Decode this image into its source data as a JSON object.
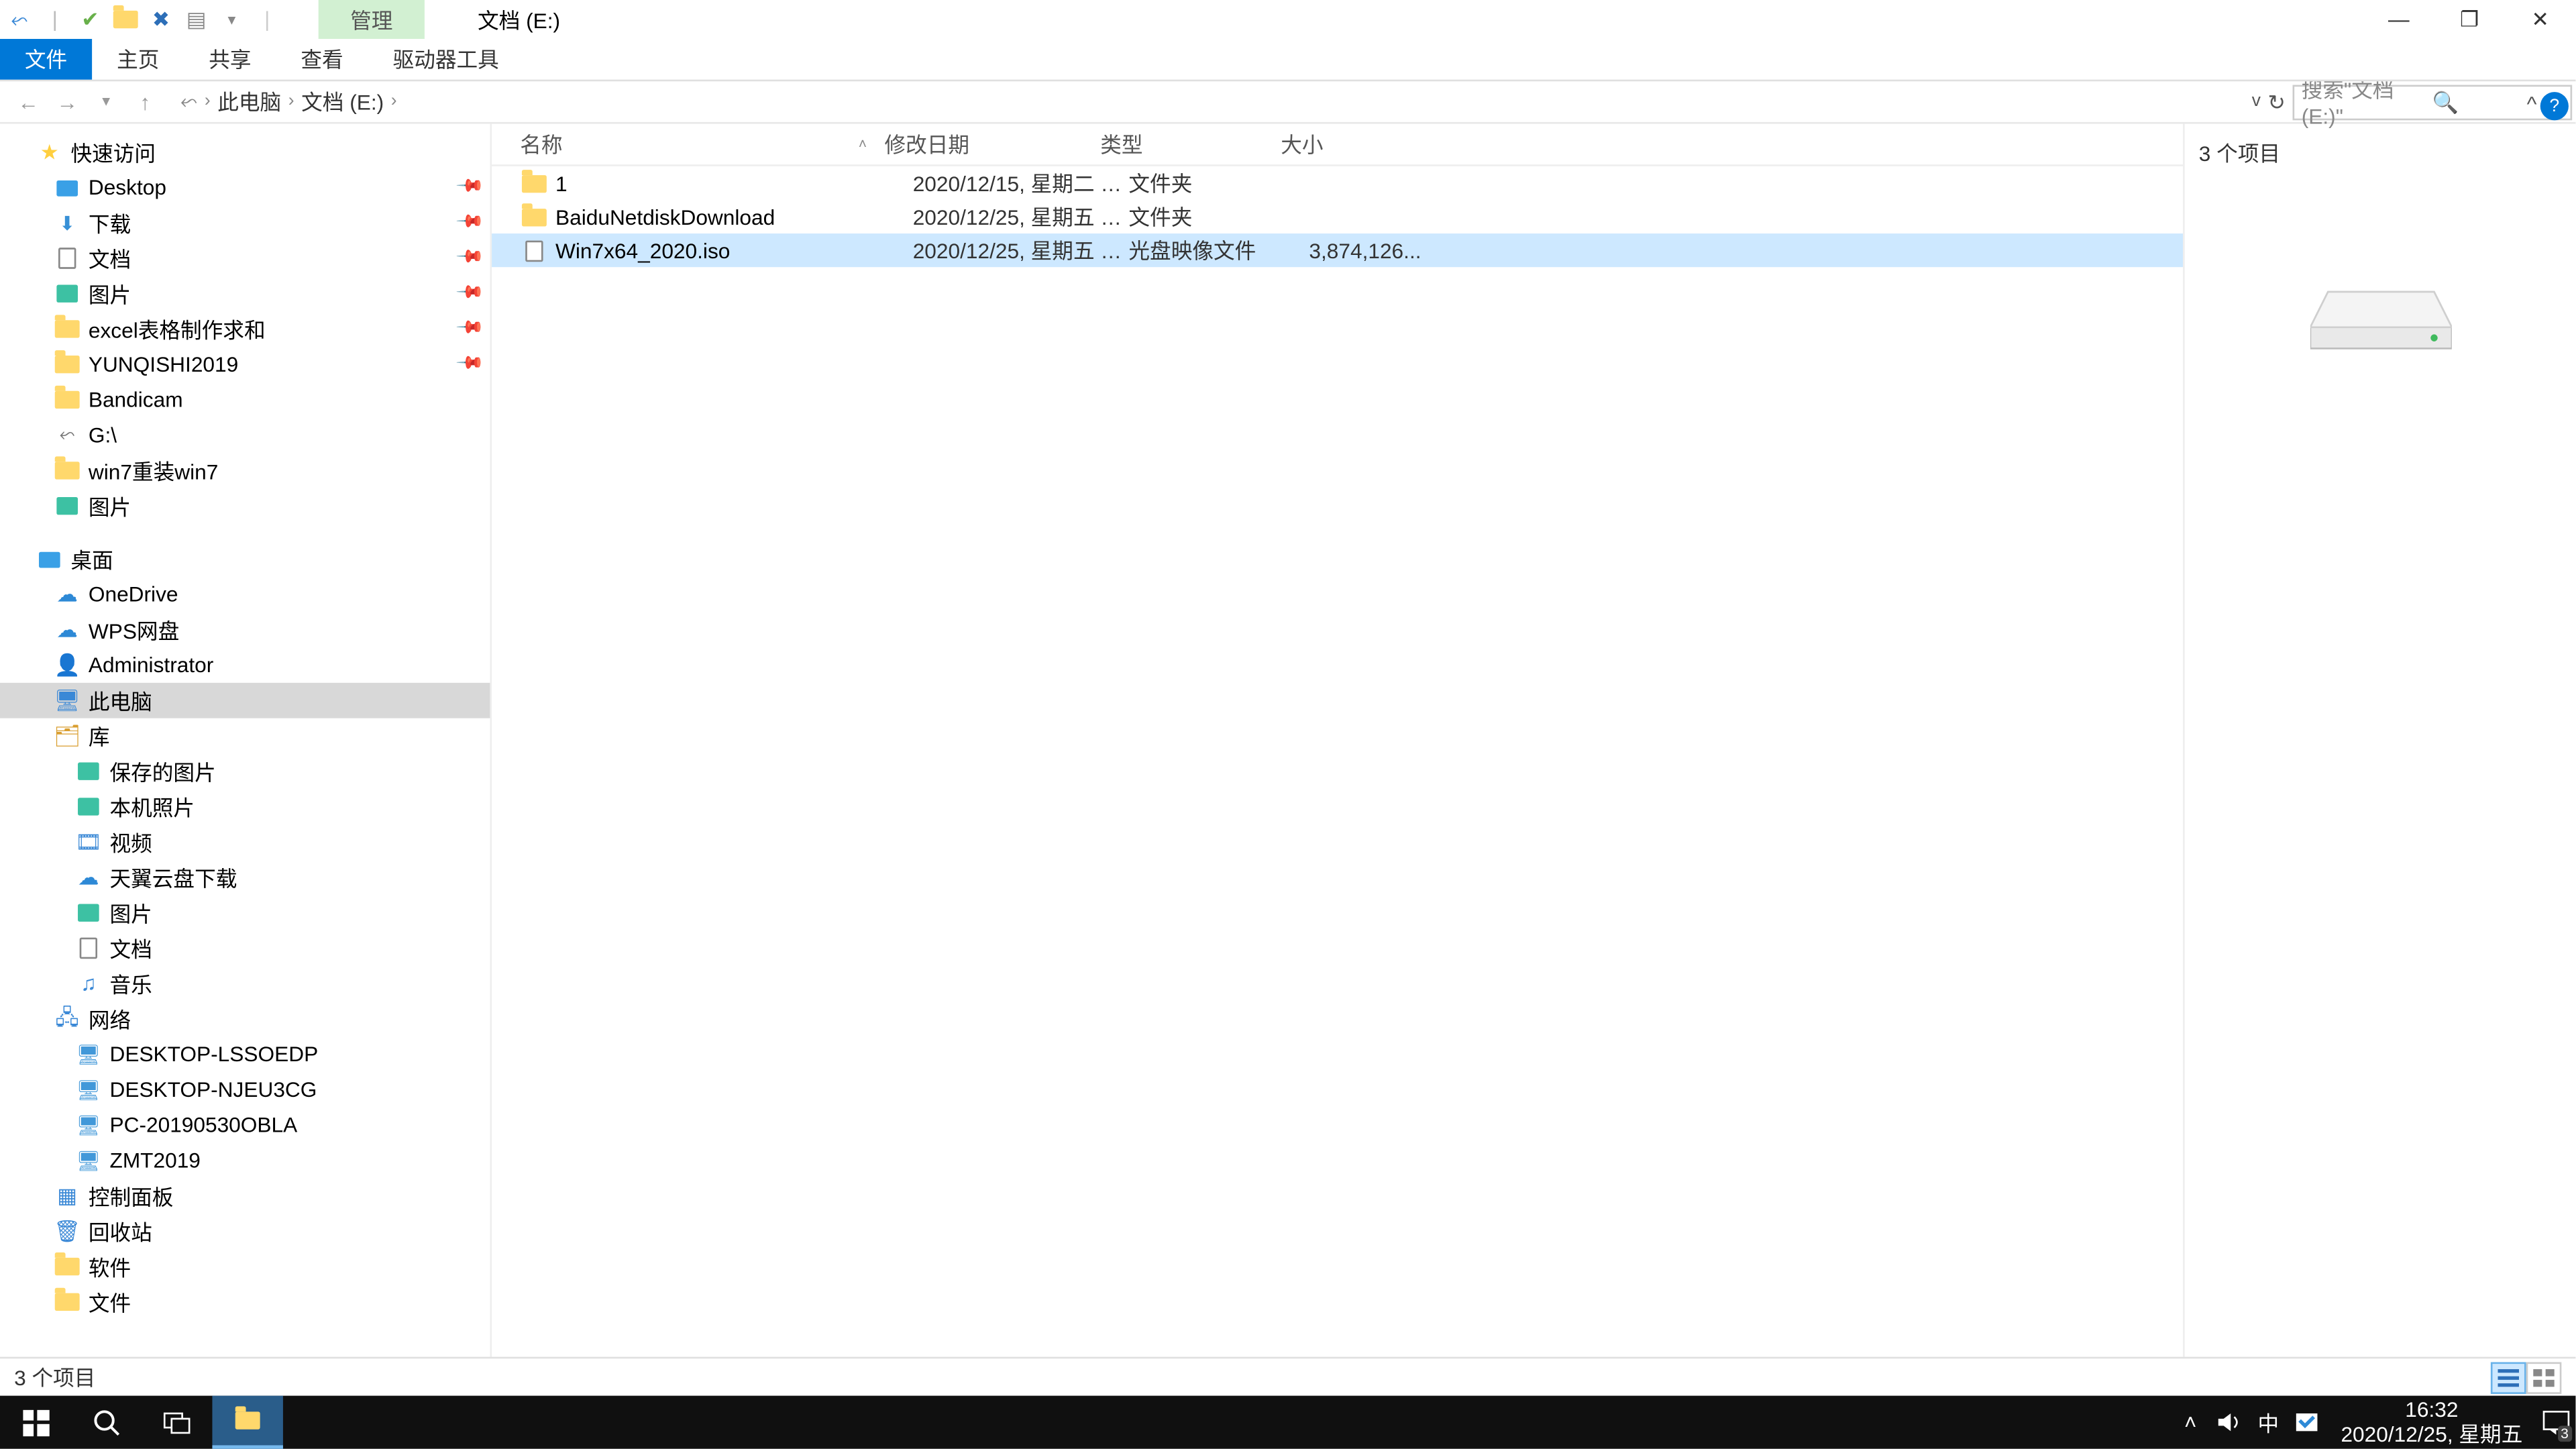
{
  "window": {
    "contextual_tab": "管理",
    "title": "文档 (E:)",
    "minimize": "—",
    "maximize": "❐",
    "close": "✕"
  },
  "ribbon": {
    "tabs": [
      "文件",
      "主页",
      "共享",
      "查看",
      "驱动器工具"
    ],
    "help": "?",
    "expand": "^"
  },
  "breadcrumb": {
    "segments": [
      "此电脑",
      "文档 (E:)"
    ],
    "sep": "›"
  },
  "search": {
    "placeholder": "搜索\"文档 (E:)\"",
    "refresh": "↻"
  },
  "columns": {
    "name": "名称",
    "date": "修改日期",
    "type": "类型",
    "size": "大小"
  },
  "rows": [
    {
      "icon": "folder",
      "name": "1",
      "date": "2020/12/15, 星期二 1...",
      "type": "文件夹",
      "size": ""
    },
    {
      "icon": "folder",
      "name": "BaiduNetdiskDownload",
      "date": "2020/12/25, 星期五 1...",
      "type": "文件夹",
      "size": ""
    },
    {
      "icon": "iso",
      "name": "Win7x64_2020.iso",
      "date": "2020/12/25, 星期五 1...",
      "type": "光盘映像文件",
      "size": "3,874,126..."
    }
  ],
  "selected_row": 2,
  "tree": {
    "quick_access": "快速访问",
    "qa": [
      {
        "icon": "desktop",
        "label": "Desktop",
        "pin": true
      },
      {
        "icon": "download",
        "label": "下载",
        "pin": true
      },
      {
        "icon": "doc",
        "label": "文档",
        "pin": true
      },
      {
        "icon": "pic",
        "label": "图片",
        "pin": true
      },
      {
        "icon": "folder",
        "label": "excel表格制作求和",
        "pin": true
      },
      {
        "icon": "folder",
        "label": "YUNQISHI2019",
        "pin": true
      },
      {
        "icon": "folder",
        "label": "Bandicam",
        "pin": false
      },
      {
        "icon": "disk",
        "label": "G:\\",
        "pin": false
      },
      {
        "icon": "folder",
        "label": "win7重装win7",
        "pin": false
      },
      {
        "icon": "pic",
        "label": "图片",
        "pin": false
      }
    ],
    "desktop": "桌面",
    "dk": [
      {
        "icon": "cloud",
        "label": "OneDrive"
      },
      {
        "icon": "cloud",
        "label": "WPS网盘"
      },
      {
        "icon": "person",
        "label": "Administrator"
      },
      {
        "icon": "monitor",
        "label": "此电脑"
      },
      {
        "icon": "lib",
        "label": "库"
      }
    ],
    "lib": [
      {
        "icon": "pic",
        "label": "保存的图片"
      },
      {
        "icon": "pic",
        "label": "本机照片"
      },
      {
        "icon": "video",
        "label": "视频"
      },
      {
        "icon": "cloud",
        "label": "天翼云盘下载"
      },
      {
        "icon": "pic",
        "label": "图片"
      },
      {
        "icon": "doc",
        "label": "文档"
      },
      {
        "icon": "music",
        "label": "音乐"
      }
    ],
    "network": "网络",
    "nw": [
      {
        "label": "DESKTOP-LSSOEDP"
      },
      {
        "label": "DESKTOP-NJEU3CG"
      },
      {
        "label": "PC-20190530OBLA"
      },
      {
        "label": "ZMT2019"
      }
    ],
    "extra": [
      {
        "icon": "panel",
        "label": "控制面板"
      },
      {
        "icon": "trash",
        "label": "回收站"
      },
      {
        "icon": "folder",
        "label": "软件"
      },
      {
        "icon": "folder",
        "label": "文件"
      }
    ]
  },
  "preview": {
    "header": "3 个项目"
  },
  "status": {
    "text": "3 个项目"
  },
  "taskbar": {
    "time": "16:32",
    "date": "2020/12/25, 星期五",
    "ime": "中",
    "notif_count": "3"
  }
}
